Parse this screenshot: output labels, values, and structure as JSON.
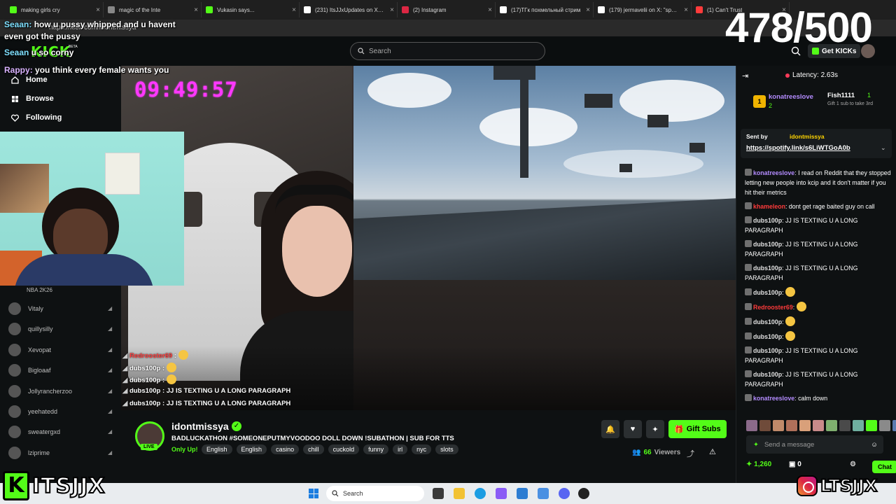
{
  "browser": {
    "tabs": [
      {
        "title": "making girls cry",
        "color": "#53fc18"
      },
      {
        "title": "magic of the Inte",
        "color": "#888888"
      },
      {
        "title": "Vukasin says...",
        "color": "#53fc18"
      },
      {
        "title": "(231) ItsJJxUpdates on X: \"Fa",
        "color": "#ffffff"
      },
      {
        "title": "(2) Instagram",
        "color": "#dc2743"
      },
      {
        "title": "(17)ТГк похмельный стрим",
        "color": "#ffffff"
      },
      {
        "title": "(179) jermavelii on X: \"space",
        "color": "#ffffff"
      },
      {
        "title": "(1) Can't Trust",
        "color": "#ff3b3b"
      }
    ],
    "url": "https://kick.com/idontmissya"
  },
  "counter": "478/500",
  "header": {
    "logo": "KICK",
    "logo_badge": "BETA",
    "search_placeholder": "Search",
    "get_kicks": "Get KICKs"
  },
  "sidebar": {
    "nav": [
      {
        "label": "Home",
        "icon": "home-icon"
      },
      {
        "label": "Browse",
        "icon": "browse-icon"
      },
      {
        "label": "Following",
        "icon": "heart-icon"
      }
    ],
    "category": "NBA 2K26",
    "channels": [
      "Vitaly",
      "quillysilly",
      "Xevopat",
      "Bigloaaf",
      "Jollyrancherzoo",
      "yeehatedd",
      "sweatergxd",
      "lziprime"
    ]
  },
  "clock": "09:49:57",
  "overlay_chat": [
    {
      "user": "Seaan",
      "text": "how u pussy whipped and u havent"
    },
    {
      "user": "",
      "text": "even got the pussy"
    },
    {
      "user": "Seaan",
      "text": "u so corny"
    },
    {
      "user": "Rappy",
      "text": "you think every female wants you"
    }
  ],
  "video_chat": [
    {
      "user": "Redrooster69",
      "text": ""
    },
    {
      "user": "dubs100p",
      "text": ""
    },
    {
      "user": "dubs100p",
      "text": ""
    },
    {
      "user": "dubs100p",
      "text": "JJ IS TEXTING U A LONG PARAGRAPH"
    },
    {
      "user": "dubs100p",
      "text": "JJ IS TEXTING U A LONG PARAGRAPH"
    }
  ],
  "stream": {
    "channel": "idontmissya",
    "live_label": "LIVE",
    "title": "BADLUCKATHON #SOMEONEPUTMYVOODOO DOLL DOWN !SUBATHON | SUB FOR TTS",
    "only_up": "Only Up!",
    "tags": [
      "English",
      "English",
      "casino",
      "chill",
      "cuckold",
      "funny",
      "irl",
      "nyc",
      "slots"
    ],
    "gift_subs": "Gift Subs",
    "viewers_count": "66",
    "viewers_label": "Viewers"
  },
  "chat": {
    "latency": "Latency: 2.63s",
    "leaderboard": [
      {
        "rank": "1",
        "user": "konatreeslove",
        "count": "2"
      },
      {
        "user": "Fish1111",
        "count": "1",
        "note": "Gift 1 sub to take 3rd"
      }
    ],
    "pinned_sent_by": "Sent by",
    "pinned_user": "idontmissya",
    "pinned_link": "https://spotify.link/s6LiWTGoA0b",
    "messages": [
      {
        "user": "konatreeslove",
        "color": "#b48cff",
        "text": "I read on Reddit that they stopped letting new people into kcip and it don't matter if you hit their metrics"
      },
      {
        "user": "khameleon",
        "color": "#ff3b3b",
        "text": "dont get rage baited guy on call"
      },
      {
        "user": "dubs100p",
        "color": "#e0e0e0",
        "text": "JJ IS TEXTING U A LONG PARAGRAPH"
      },
      {
        "user": "dubs100p",
        "color": "#e0e0e0",
        "text": "JJ IS TEXTING U A LONG PARAGRAPH"
      },
      {
        "user": "dubs100p",
        "color": "#e0e0e0",
        "text": "JJ IS TEXTING U A LONG PARAGRAPH"
      },
      {
        "user": "dubs100p",
        "color": "#e0e0e0",
        "text": ""
      },
      {
        "user": "Redrooster69",
        "color": "#ff3b3b",
        "text": ""
      },
      {
        "user": "dubs100p",
        "color": "#e0e0e0",
        "text": ""
      },
      {
        "user": "dubs100p",
        "color": "#e0e0e0",
        "text": ""
      },
      {
        "user": "dubs100p",
        "color": "#e0e0e0",
        "text": "JJ IS TEXTING U A LONG PARAGRAPH"
      },
      {
        "user": "dubs100p",
        "color": "#e0e0e0",
        "text": "JJ IS TEXTING U A LONG PARAGRAPH"
      },
      {
        "user": "konatreeslove",
        "color": "#b48cff",
        "text": "calm down"
      }
    ],
    "input_placeholder": "Send a message",
    "points": "1,260",
    "subs": "0",
    "chat_button": "Chat"
  },
  "branding": {
    "left": "ITSJJX",
    "right": "LTSJJX"
  },
  "taskbar": {
    "search": "Search"
  }
}
